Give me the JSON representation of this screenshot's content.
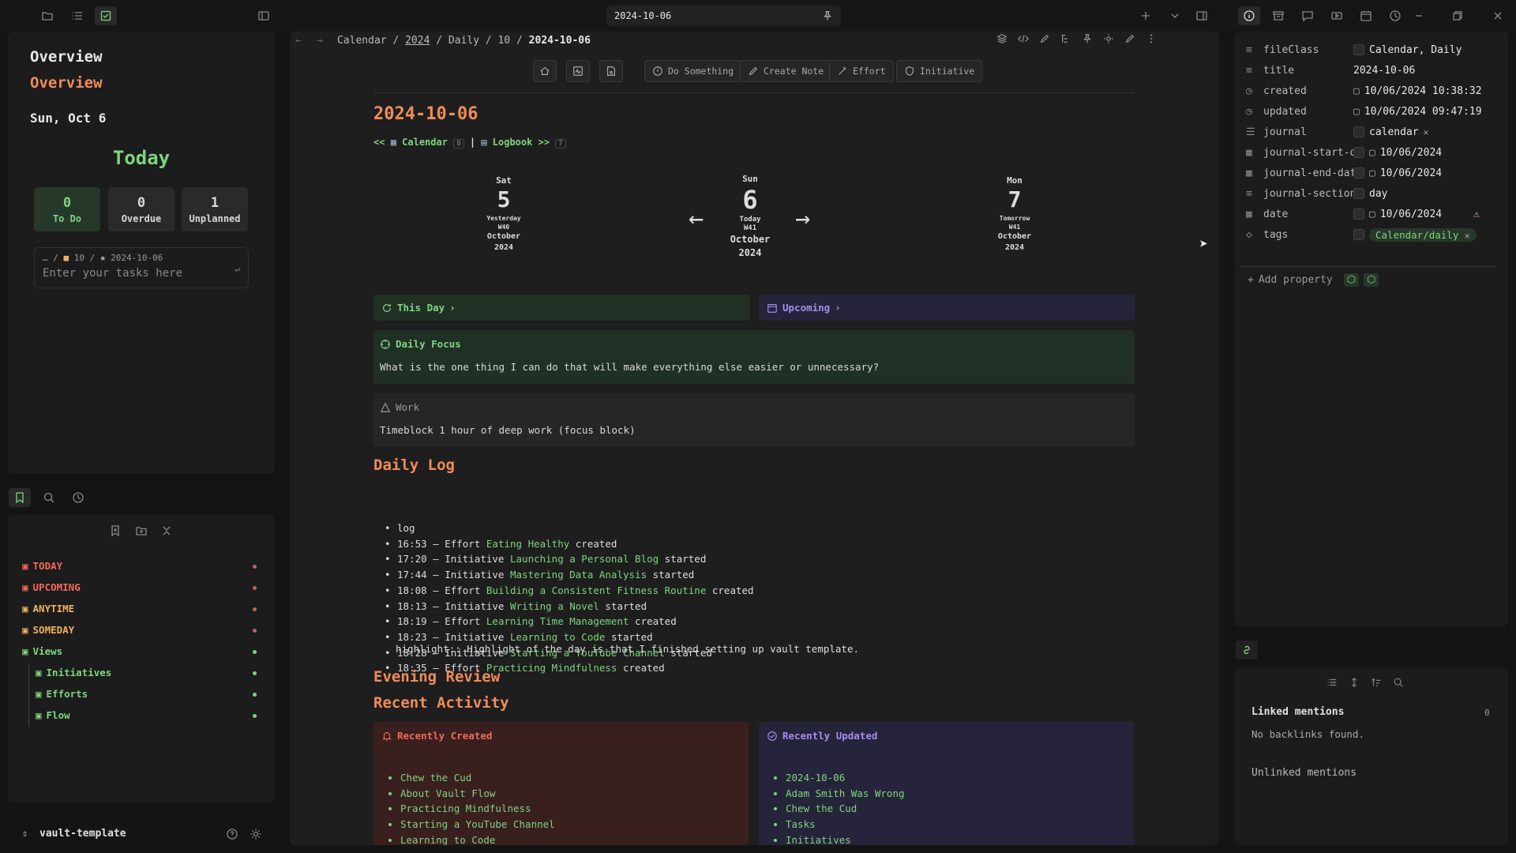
{
  "tab": {
    "title": "2024-10-06"
  },
  "sidebar": {
    "overview_title": "Overview",
    "overview_sub": "Overview",
    "date_label": "Sun, Oct 6",
    "today_label": "Today",
    "stats": [
      {
        "value": "0",
        "label": "To Do"
      },
      {
        "value": "0",
        "label": "Overdue"
      },
      {
        "value": "1",
        "label": "Unplanned"
      }
    ],
    "task_path": {
      "sep1": "… /",
      "folder": "10",
      "sep2": "/",
      "file": "2024-10-06"
    },
    "task_placeholder": "Enter your tasks here",
    "nav": [
      {
        "label": "TODAY",
        "color": "#f26a5a"
      },
      {
        "label": "UPCOMING",
        "color": "#f26a5a"
      },
      {
        "label": "ANYTIME",
        "color": "#f0b060"
      },
      {
        "label": "SOMEDAY",
        "color": "#f0b060"
      },
      {
        "label": "Views",
        "color": "#7fd47f"
      },
      {
        "label": "Initiatives",
        "color": "#7fd47f"
      },
      {
        "label": "Efforts",
        "color": "#7fd47f"
      },
      {
        "label": "Flow",
        "color": "#7fd47f"
      }
    ],
    "vault_name": "vault-template"
  },
  "breadcrumb": {
    "a": "Calendar",
    "b": "2024",
    "c": "Daily",
    "d": "10",
    "e": "2024-10-06",
    "sep": "/"
  },
  "toolbar": {
    "do_something": "Do Something",
    "create_note": "Create Note",
    "effort": "Effort",
    "initiative": "Initiative"
  },
  "note": {
    "title": "2024-10-06",
    "nav_prev": "<<",
    "calendar_link": "Calendar",
    "calendar_count": "8",
    "pipe": "|",
    "logbook_link": "Logbook",
    "nav_next": ">>",
    "logbook_count": "7",
    "days": [
      {
        "dow": "Sat",
        "num": "5",
        "rel": "Yesterday",
        "week": "W40",
        "month": "October",
        "year": "2024"
      },
      {
        "dow": "Sun",
        "num": "6",
        "rel": "Today",
        "week": "W41",
        "month": "October",
        "year": "2024"
      },
      {
        "dow": "Mon",
        "num": "7",
        "rel": "Tomorrow",
        "week": "W41",
        "month": "October",
        "year": "2024"
      }
    ],
    "this_day": "This Day",
    "upcoming": "Upcoming",
    "focus_title": "Daily Focus",
    "focus_body": "What is the one thing I can do that will make everything else easier or unnecessary?",
    "work_title": "Work",
    "work_body": "Timeblock 1 hour of deep work (focus block)",
    "daily_log_heading": "Daily Log",
    "log": [
      {
        "pre": "log",
        "link": "",
        "post": ""
      },
      {
        "pre": "16:53 – Effort ",
        "link": "Eating Healthy",
        "post": " created"
      },
      {
        "pre": "17:20 – Initiative ",
        "link": "Launching a Personal Blog",
        "post": " started"
      },
      {
        "pre": "17:44 – Initiative ",
        "link": "Mastering Data Analysis",
        "post": " started"
      },
      {
        "pre": "18:08 – Effort ",
        "link": "Building a Consistent Fitness Routine",
        "post": " created"
      },
      {
        "pre": "18:13 – Initiative ",
        "link": "Writing a Novel",
        "post": " started"
      },
      {
        "pre": "18:19 – Effort ",
        "link": "Learning Time Management",
        "post": " created"
      },
      {
        "pre": "18:23 – Initiative ",
        "link": "Learning to Code",
        "post": " started"
      },
      {
        "pre": "18:28 – Initiative ",
        "link": "Starting a YouTube Channel",
        "post": " started"
      },
      {
        "pre": "18:35 – Effort ",
        "link": "Practicing Mindfulness",
        "post": " created"
      }
    ],
    "highlight": "highlight:: Highlight of the day is that I finished setting up vault template.",
    "evening_heading": "Evening Review",
    "recent_heading": "Recent Activity",
    "recently_created_title": "Recently Created",
    "recently_created": [
      "Chew the Cud",
      "About Vault Flow",
      "Practicing Mindfulness",
      "Starting a YouTube Channel",
      "Learning to Code"
    ],
    "recently_updated_title": "Recently Updated",
    "recently_updated": [
      "2024-10-06",
      "Adam Smith Was Wrong",
      "Chew the Cud",
      "Tasks",
      "Initiatives"
    ]
  },
  "properties": [
    {
      "key": "fileClass",
      "value": "Calendar, Daily"
    },
    {
      "key": "title",
      "value": "2024-10-06"
    },
    {
      "key": "created",
      "value": "10/06/2024 10:38:32"
    },
    {
      "key": "updated",
      "value": "10/06/2024 09:47:19"
    },
    {
      "key": "journal",
      "value": "calendar"
    },
    {
      "key": "journal-start-date",
      "value": "10/06/2024"
    },
    {
      "key": "journal-end-date",
      "value": "10/06/2024"
    },
    {
      "key": "journal-section",
      "value": "day"
    },
    {
      "key": "date",
      "value": "10/06/2024"
    },
    {
      "key": "tags",
      "value": "Calendar/daily"
    }
  ],
  "add_property": "Add property",
  "backlinks": {
    "linked_title": "Linked mentions",
    "linked_count": "0",
    "none_found": "No backlinks found.",
    "unlinked_title": "Unlinked mentions"
  },
  "colors": {
    "accent_orange": "#f08c5a",
    "accent_green": "#7fd47f",
    "accent_purple": "#a58cf0",
    "accent_red": "#f26a5a"
  }
}
